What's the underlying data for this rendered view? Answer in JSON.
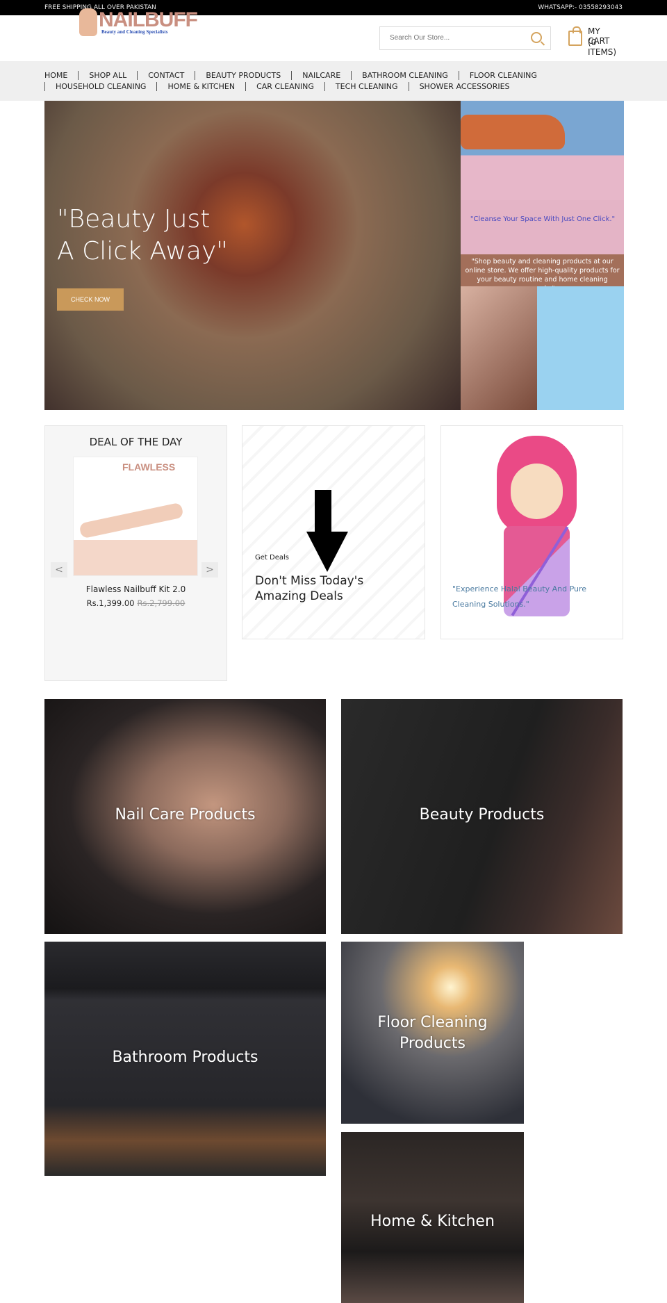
{
  "topbar": {
    "left": "FREE SHIPPING ALL OVER PAKISTAN",
    "right": "WHATSAPP:- 03558293043"
  },
  "header": {
    "logo": {
      "word": "NAILBUFF",
      "tagline": "Beauty and Cleaning Specialists"
    },
    "search": {
      "placeholder": "Search Our Store...",
      "icon": "search-icon"
    },
    "cart": {
      "line1": "MY CART",
      "line2": "(0 ITEMS)",
      "icon": "shopping-bag-icon"
    }
  },
  "nav": {
    "row1": [
      "HOME",
      "SHOP ALL",
      "CONTACT",
      "BEAUTY PRODUCTS",
      "NAILCARE",
      "BATHROOM CLEANING",
      "FLOOR CLEANING"
    ],
    "row2": [
      "HOUSEHOLD CLEANING",
      "HOME & KITCHEN",
      "CAR CLEANING",
      "TECH CLEANING",
      "SHOWER ACCESSORIES"
    ]
  },
  "hero": {
    "headline_1": "\"Beauty Just",
    "headline_2": "A Click Away\"",
    "cta": "CHECK NOW",
    "side_quote": "\"Cleanse Your Space With Just One Click.\"",
    "side_text": "\"Shop beauty and cleaning products at our online store. We offer high-quality products for your beauty routine and home cleaning needs.\""
  },
  "deal": {
    "title": "DEAL OF THE DAY",
    "image_text": "FLAWLESS",
    "product_name": "Flawless Nailbuff Kit 2.0",
    "price": "Rs.1,399.00",
    "old_price": "Rs.2,799.00",
    "prev": "<",
    "next": ">"
  },
  "promo": {
    "small": "Get Deals",
    "big": "Don't Miss Today's Amazing Deals"
  },
  "halal": {
    "quote": "\"Experience Halal Beauty And Pure Cleaning Solutions.\""
  },
  "categories": [
    {
      "label": "Nail Care Products"
    },
    {
      "label": "Beauty Products"
    },
    {
      "label": "Bathroom Products"
    },
    {
      "label": "Floor Cleaning Products"
    },
    {
      "label": "Home & Kitchen"
    }
  ],
  "colors": {
    "accent": "#c9995a",
    "topbar": "#000000",
    "nav_bg": "#efefef"
  }
}
